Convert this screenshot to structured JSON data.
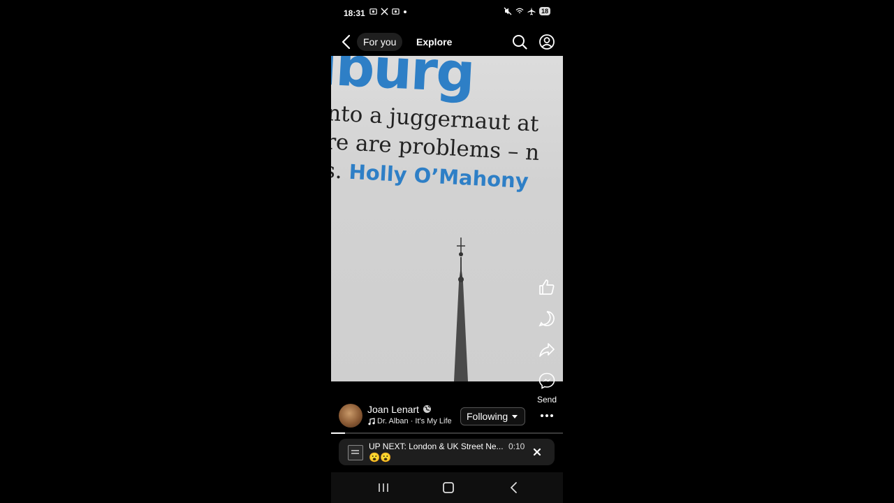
{
  "status_bar": {
    "time": "18:31",
    "battery": "18"
  },
  "top_nav": {
    "tabs": [
      {
        "label": "For you",
        "selected": true
      },
      {
        "label": "Explore",
        "selected": false
      }
    ]
  },
  "video": {
    "headline_fragment": "iburg",
    "quote_lines": [
      "nto a juggernaut at",
      "re are problems – n"
    ],
    "quote_line3_prefix": "s.",
    "quote_author": "Holly O’Mahony"
  },
  "actions": {
    "send_label": "Send"
  },
  "author": {
    "name": "Joan Lenart",
    "music": "Dr. Alban · It's My Life",
    "follow_label": "Following"
  },
  "progress": 0.06,
  "up_next": {
    "title": "UP NEXT: London & UK Street Ne...",
    "emoji": "😮😮",
    "duration": "0:10"
  },
  "colors": {
    "accent_blue": "#2e7fc6",
    "background": "#000000",
    "card": "#1e1e1e"
  }
}
